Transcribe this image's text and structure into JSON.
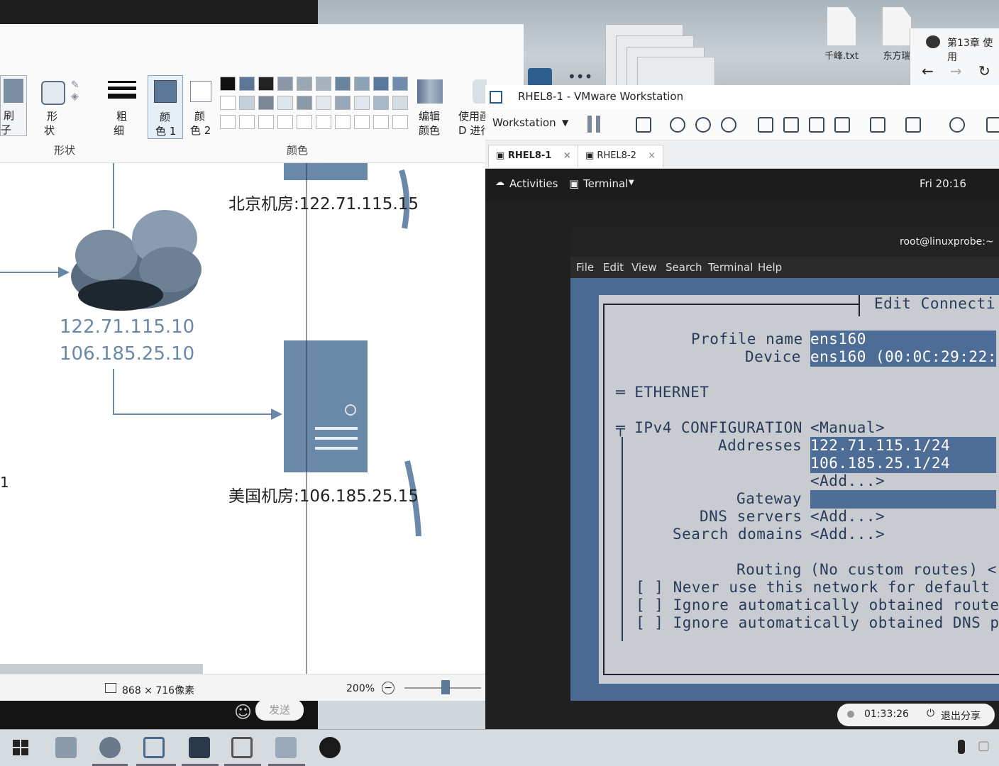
{
  "desktop": {
    "icons": [
      {
        "label": "千峰.txt"
      },
      {
        "label": "东方瑞"
      }
    ],
    "browser_tab": "第13章 使用"
  },
  "paint": {
    "toolbar": {
      "brush_label_1": "刷",
      "brush_label_2": "子",
      "shapes_label_1": "形",
      "shapes_label_2": "状",
      "shapes_group": "形状",
      "size_label_1": "粗",
      "size_label_2": "细",
      "color1_label_1": "颜",
      "color1_label_2": "色 1",
      "color2_label_1": "颜",
      "color2_label_2": "色 2",
      "colors_group": "颜色",
      "edit_colors_1": "编辑",
      "edit_colors_2": "颜色",
      "use_paint3d_1": "使用画",
      "use_paint3d_2": "D 进行"
    },
    "canvas": {
      "beijing_label": "北京机房:122.71.115.15",
      "usa_label": "美国机房:106.185.25.15",
      "cloud_ip_1": "122.71.115.10",
      "cloud_ip_2": "106.185.25.10",
      "edge_label": "1"
    },
    "status": {
      "dimensions": "868 × 716像素",
      "zoom": "200%",
      "zoom_level_percent": 50
    },
    "chat_send": "发送"
  },
  "vmware": {
    "title": "RHEL8-1 - VMware Workstation",
    "menu_label": "Workstation",
    "tabs": [
      {
        "label": "RHEL8-1"
      },
      {
        "label": "RHEL8-2"
      }
    ],
    "gnome": {
      "activities": "Activities",
      "app_menu": "Terminal",
      "clock": "Fri 20:16"
    },
    "terminal": {
      "title": "root@linuxprobe:~",
      "menu": [
        "File",
        "Edit",
        "View",
        "Search",
        "Terminal",
        "Help"
      ]
    },
    "nmtui": {
      "header": "Edit Connecti",
      "profile_name_label": "Profile name",
      "profile_name_value": "ens160",
      "device_label": "Device",
      "device_value": "ens160 (00:0C:29:22:",
      "ethernet": "═ ETHERNET",
      "ipv4_label": "╤ IPv4 CONFIGURATION",
      "ipv4_mode": "<Manual>",
      "addresses_label": "Addresses",
      "address_1": "122.71.115.1/24",
      "address_2": "106.185.25.1/24",
      "add_address": "<Add...>",
      "gateway_label": "Gateway",
      "dns_label": "DNS servers",
      "dns_add": "<Add...>",
      "search_label": "Search domains",
      "search_add": "<Add...>",
      "routing_label": "Routing",
      "routing_value": "(No custom routes) <",
      "check_1": "[ ] Never use this network for default",
      "check_2": "[ ] Ignore automatically obtained route",
      "check_3": "[ ] Ignore automatically obtained DNS pa"
    }
  },
  "share": {
    "timer": "01:33:26",
    "exit_label": "退出分享"
  }
}
